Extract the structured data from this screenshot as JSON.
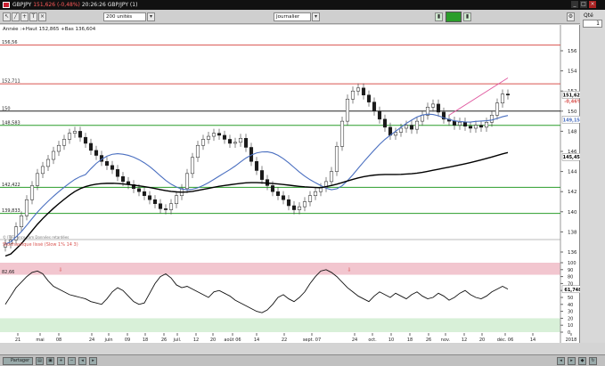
{
  "window": {
    "symbol": "GBPJPY",
    "price": "151,626",
    "change": "(-0,48%)",
    "time": "20:26:26",
    "description": "GBP/JPY (1)"
  },
  "toolbar": {
    "units": "200 unités",
    "period": "Journalier",
    "qty_label": "Qté",
    "qty_value": "1"
  },
  "chart": {
    "info": "Année :+Haut 152,865 +Bas 136,604",
    "source": "© IT-Finance.com Données retardées",
    "y_ticks": [
      "156",
      "154",
      "152",
      "150",
      "148",
      "146",
      "144",
      "142",
      "140",
      "138",
      "136"
    ],
    "level_labels": [
      "156,56",
      "152,711",
      "150",
      "148,583",
      "142,422",
      "139,833"
    ],
    "price_tag": "151,626",
    "change_tag": "-0,46%",
    "ma_tag": "149,153",
    "ma2_tag": "145,452",
    "x_labels": [
      "21",
      "mai",
      "08",
      "24",
      "juin",
      "09",
      "18",
      "26",
      "juil.",
      "12",
      "20",
      "août 06",
      "14",
      "22",
      "sept. 07",
      "24",
      "oct.",
      "10",
      "18",
      "26",
      "nov.",
      "12",
      "20",
      "déc. 06",
      "14",
      "2018"
    ]
  },
  "oscillator": {
    "title": "Stochastique lissé (Slow 1% 14 3)",
    "level": "82,66",
    "y_ticks": [
      "100",
      "90",
      "80",
      "70",
      "60",
      "50",
      "40",
      "30",
      "20",
      "10",
      "0"
    ],
    "value_tag": "61,748"
  },
  "status": {
    "share_label": "Partager"
  },
  "colors": {
    "accent_green": "#2a9d2a",
    "ma_blue": "#4a6fc0",
    "overbought_zone": "#f2c6cf",
    "oversold_zone": "#d8f0d8"
  }
}
